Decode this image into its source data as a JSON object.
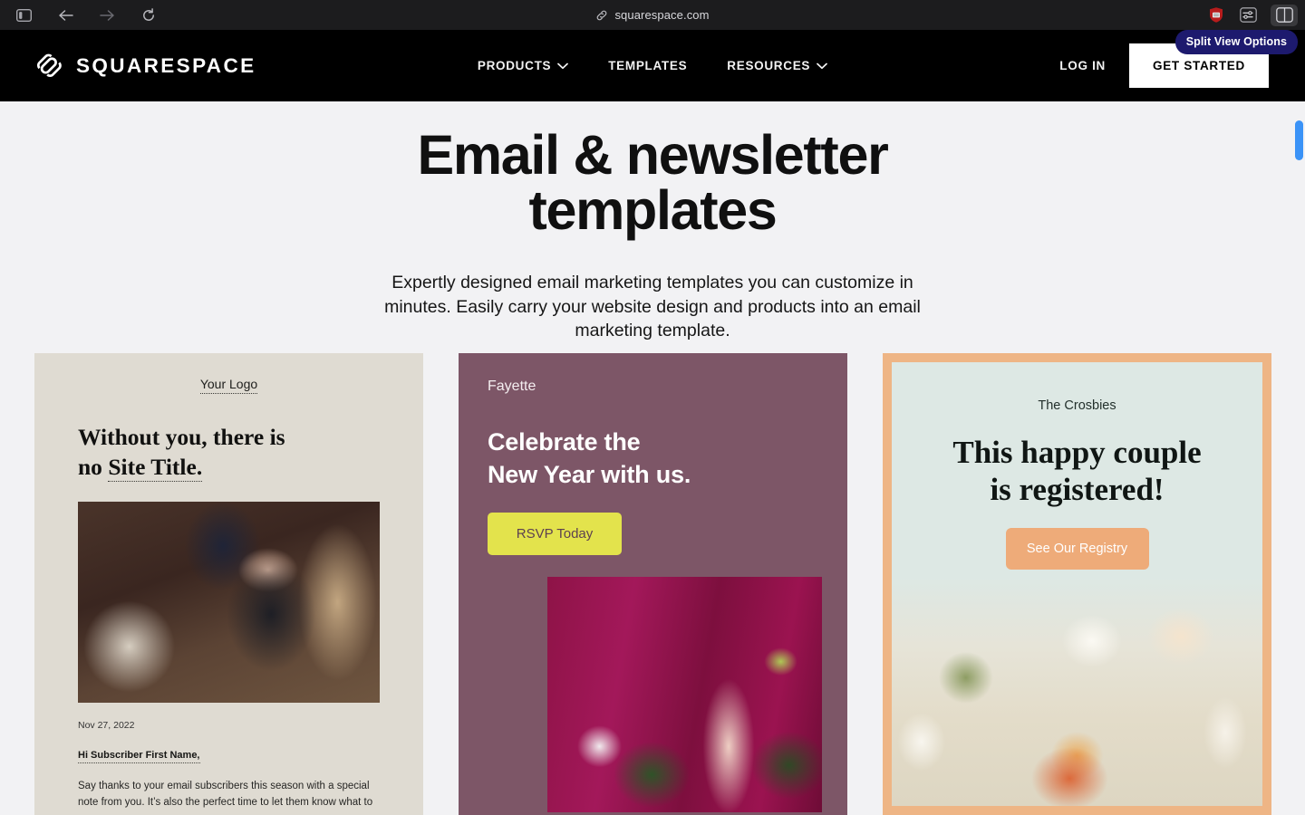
{
  "browser": {
    "sidebar_icon": "sidebar-toggle-icon",
    "back_icon": "back-arrow-icon",
    "forward_icon": "forward-arrow-icon",
    "reload_icon": "reload-icon",
    "link_icon": "link-icon",
    "url": "squarespace.com",
    "extension_icon": "shield-extension-icon",
    "settings_icon": "page-settings-icon",
    "split_view_icon": "split-view-icon",
    "tooltip": "Split View Options",
    "tooltip_bg": "#1d1a6e"
  },
  "site_nav": {
    "logo_icon": "squarespace-logo-icon",
    "brand": "SQUARESPACE",
    "links": [
      {
        "label": "PRODUCTS",
        "has_chevron": true,
        "icon": "chevron-down-icon"
      },
      {
        "label": "TEMPLATES",
        "has_chevron": false,
        "icon": ""
      },
      {
        "label": "RESOURCES",
        "has_chevron": true,
        "icon": "chevron-down-icon"
      }
    ],
    "login": "LOG IN",
    "cta": "GET STARTED",
    "bg": "#000000"
  },
  "hero": {
    "title": "Email & newsletter templates",
    "subtitle": "Expertly designed email marketing templates you can customize in minutes. Easily carry your website design and products into an email marketing template."
  },
  "cards": [
    {
      "id": "card-without-you",
      "bg": "#dfdbd2",
      "logo": "Your Logo",
      "headline_line1": "Without you, there is",
      "headline_line2_plain": "no ",
      "headline_line2_dotted": "Site Title.",
      "photo_alt": "woman-in-workshop-photo",
      "date": "Nov 27, 2022",
      "greeting": "Hi Subscriber First Name,",
      "body": "Say thanks to your email subscribers this season with a special note from you. It’s also the perfect time to let them know what to"
    },
    {
      "id": "card-fayette",
      "bg": "#7d5667",
      "brand": "Fayette",
      "headline_line1": "Celebrate the",
      "headline_line2": "New Year with us.",
      "button": "RSVP Today",
      "button_bg": "#e3e34c",
      "button_color": "#5d4150",
      "photo_alt": "cocktail-dragonfruit-photo"
    },
    {
      "id": "card-crosbies",
      "bg": "#eeb585",
      "inner_bg": "#dde8e4",
      "brand": "The Crosbies",
      "headline_line1": "This happy couple",
      "headline_line2": "is registered!",
      "button": "See Our Registry",
      "button_bg": "#eeab79",
      "photo_alt": "floral-arrangement-photo"
    }
  ],
  "scrollbar": {
    "color": "#3b93f7"
  }
}
